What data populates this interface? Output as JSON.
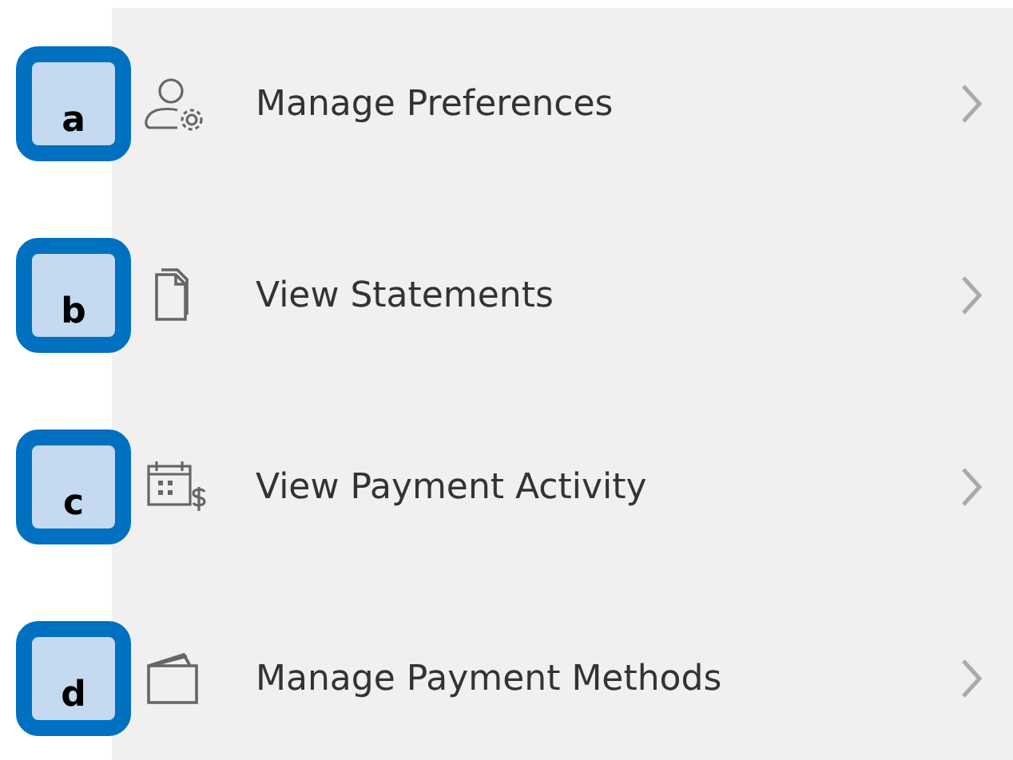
{
  "menu_items": [
    {
      "badge": "a",
      "label": "Manage Preferences"
    },
    {
      "badge": "b",
      "label": "View Statements"
    },
    {
      "badge": "c",
      "label": "View Payment Activity"
    },
    {
      "badge": "d",
      "label": "Manage Payment Methods"
    }
  ]
}
